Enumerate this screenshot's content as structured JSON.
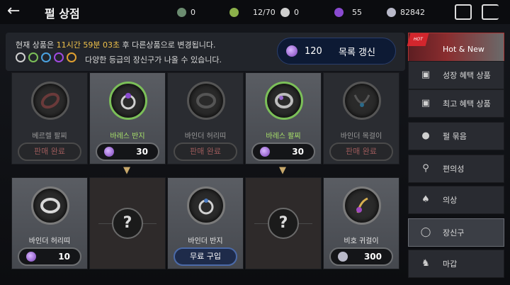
{
  "header": {
    "title": "펄 상점"
  },
  "currencies": [
    {
      "icon": "green-stone-icon",
      "value": "0",
      "color": "#6b8c70"
    },
    {
      "icon": "leaf-coin-icon",
      "value": "12/70",
      "color": "#8bb04a"
    },
    {
      "icon": "pearl-icon",
      "value": "0",
      "color": "#cfcfcf"
    },
    {
      "icon": "purple-pearl-icon",
      "value": "55",
      "color": "#8a4ad0"
    },
    {
      "icon": "silver-icon",
      "value": "82842",
      "color": "#b9b9c9"
    }
  ],
  "notice": {
    "prefix": "현재 상품은 ",
    "time": "11시간 59분 03초",
    "suffix": " 후 다른상품으로 변경됩니다.",
    "grade_text": "다양한 등급의 장신구가 나올 수 있습니다.",
    "grade_colors": [
      "#d0d0d0",
      "#7bbf58",
      "#4aa2e0",
      "#a04ae0",
      "#e0a030"
    ]
  },
  "refresh": {
    "count": "120",
    "label": "목록 갱신"
  },
  "items_row1": [
    {
      "name": "베르렐 팔찌",
      "state": "sold",
      "label": "판매 완료"
    },
    {
      "name": "바레스 반지",
      "state": "price",
      "price": "30"
    },
    {
      "name": "바인더 허리띠",
      "state": "sold",
      "label": "판매 완료"
    },
    {
      "name": "바레스 팔찌",
      "state": "price",
      "price": "30"
    },
    {
      "name": "바인더 목걸이",
      "state": "sold",
      "label": "판매 완료"
    }
  ],
  "items_row2": [
    {
      "name": "바인더 허리띠",
      "state": "price",
      "price": "10"
    },
    {
      "name": "?",
      "state": "locked"
    },
    {
      "name": "바인더 반지",
      "state": "free",
      "label": "무료 구입"
    },
    {
      "name": "?",
      "state": "locked"
    },
    {
      "name": "비호 귀걸이",
      "state": "silver",
      "price": "300"
    }
  ],
  "sidebar": {
    "hot": {
      "tag": "HOT",
      "label": "Hot & New"
    },
    "items": [
      {
        "label": "성장 혜택 상품",
        "icon": "box-icon"
      },
      {
        "label": "최고 혜택 상품",
        "icon": "box-icon"
      },
      {
        "label": "펄 묶음",
        "icon": "pearls-icon"
      },
      {
        "label": "편의성",
        "icon": "potion-icon"
      },
      {
        "label": "의상",
        "icon": "costume-icon"
      },
      {
        "label": "장신구",
        "icon": "ring-icon"
      },
      {
        "label": "마갑",
        "icon": "horse-icon"
      }
    ]
  }
}
